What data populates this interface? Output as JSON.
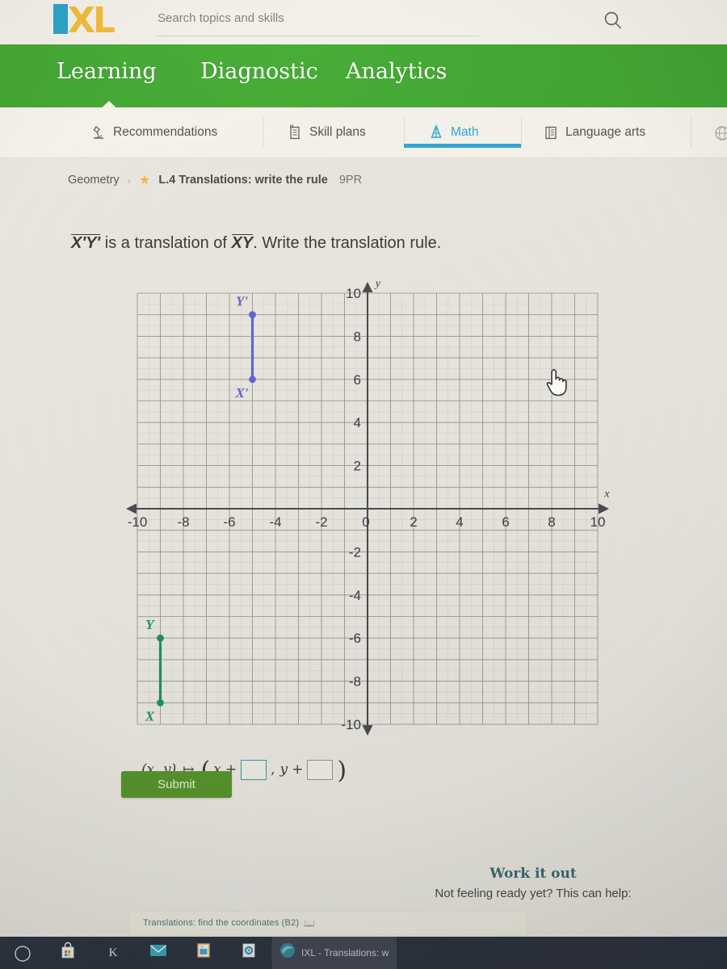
{
  "app": {
    "name": "IXL",
    "brand_blue": "#1799c6",
    "brand_yellow": "#f0b429",
    "nav_green": "#2f9e20",
    "accent_blue": "#1a9fd4"
  },
  "search": {
    "placeholder": "Search topics and skills",
    "value": "",
    "icon": "search-icon"
  },
  "mainnav": {
    "items": [
      {
        "label": "Learning",
        "active": true
      },
      {
        "label": "Diagnostic",
        "active": false
      },
      {
        "label": "Analytics",
        "active": false
      }
    ]
  },
  "subnav": {
    "items": [
      {
        "label": "Recommendations",
        "icon": "microscope-icon",
        "active": false
      },
      {
        "label": "Skill plans",
        "icon": "clipboard-icon",
        "active": false
      },
      {
        "label": "Math",
        "icon": "compass-icon",
        "active": true
      },
      {
        "label": "Language arts",
        "icon": "book-icon",
        "active": false
      }
    ],
    "overflow_icon": "globe-icon"
  },
  "breadcrumb": {
    "subject": "Geometry",
    "separator": "›",
    "star_icon": "star-icon",
    "skill": "L.4 Translations: write the rule",
    "code": "9PR"
  },
  "question": {
    "segment_image": "X'Y'",
    "segment_preimage": "XY",
    "text_before": " is a translation of ",
    "text_after": ". Write the translation rule."
  },
  "answer": {
    "prefix_x": "x",
    "prefix_y": "y",
    "map_arrow": "↦",
    "plus": "+",
    "comma": ",",
    "box1_value": "",
    "box2_value": "",
    "box1_focused": true
  },
  "submit": {
    "label": "Submit"
  },
  "workitout": {
    "title": "Work it out",
    "subtitle": "Not feeling ready yet? This can help:"
  },
  "suggestion": {
    "label": "Translations: find the coordinates (B2)",
    "badge_icon": "book-icon"
  },
  "cursor": {
    "icon": "pointing-hand-cursor"
  },
  "taskbar": {
    "items": [
      {
        "name": "start-button",
        "icon": "cortana-circle-icon",
        "label": ""
      },
      {
        "name": "microsoft-store",
        "icon": "store-bag-icon",
        "label": ""
      },
      {
        "name": "kami-app",
        "icon": "k-icon",
        "label": "K"
      },
      {
        "name": "mail-app",
        "icon": "mail-envelope-icon",
        "label": ""
      },
      {
        "name": "photos-app",
        "icon": "photo-icon",
        "label": ""
      },
      {
        "name": "settings-app",
        "icon": "gear-icon",
        "label": ""
      }
    ],
    "active_window": {
      "icon": "edge-icon",
      "label": "IXL - Translations: w"
    }
  },
  "chart_data": {
    "type": "scatter",
    "title": "",
    "xlabel": "x",
    "ylabel": "y",
    "xlim": [
      -10,
      10
    ],
    "ylim": [
      -10,
      10
    ],
    "xticks": [
      -10,
      -8,
      -6,
      -4,
      -2,
      0,
      2,
      4,
      6,
      8,
      10
    ],
    "yticks": [
      10,
      8,
      6,
      4,
      2,
      -2,
      -4,
      -6,
      -8,
      -10
    ],
    "grid": true,
    "minor_grid": true,
    "minor_grid_step": 0.5,
    "grid_step": 1,
    "legend": "none",
    "origin_label": "0",
    "series": [
      {
        "name": "X'Y'",
        "color": "#5757cc",
        "kind": "segment",
        "points": [
          {
            "label": "X'",
            "x": -5,
            "y": 6,
            "label_pos": "below"
          },
          {
            "label": "Y'",
            "x": -5,
            "y": 9,
            "label_pos": "above"
          }
        ]
      },
      {
        "name": "XY",
        "color": "#0f8a4f",
        "kind": "segment",
        "points": [
          {
            "label": "X",
            "x": -9,
            "y": -9,
            "label_pos": "below"
          },
          {
            "label": "Y",
            "x": -9,
            "y": -6,
            "label_pos": "above"
          }
        ]
      }
    ],
    "annotations": [
      {
        "text": "y",
        "x": 0.45,
        "y": 10.3
      },
      {
        "text": "x",
        "x": 10.4,
        "y": 0.55
      }
    ]
  }
}
